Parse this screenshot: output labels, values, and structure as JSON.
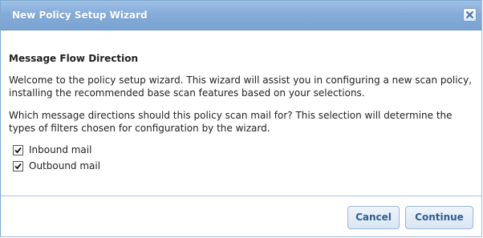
{
  "dialog": {
    "title": "New Policy Setup Wizard",
    "close_icon": "close-icon"
  },
  "content": {
    "heading": "Message Flow Direction",
    "intro": "Welcome to the policy setup wizard. This wizard will assist you in configuring a new scan policy, installing the recommended base scan features based on your selections.",
    "question": "Which message directions should this policy scan mail for? This selection will determine the types of filters chosen for configuration by the wizard.",
    "options": [
      {
        "label": "Inbound mail",
        "checked": true
      },
      {
        "label": "Outbound mail",
        "checked": true
      }
    ]
  },
  "footer": {
    "cancel_label": "Cancel",
    "continue_label": "Continue"
  },
  "colors": {
    "titlebar": "#85acd9",
    "button_text": "#2f5d8e",
    "divider": "#a9c4e2"
  }
}
